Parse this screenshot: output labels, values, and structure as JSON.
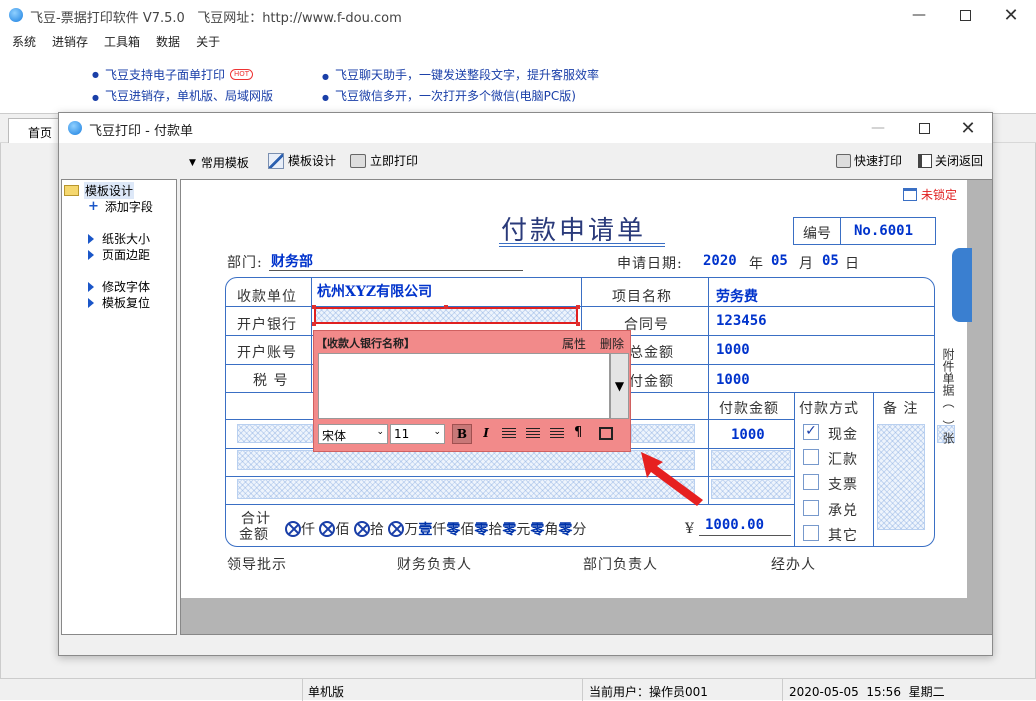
{
  "app": {
    "title": "飞豆-票据打印软件 V7.5.0   飞豆网址：http://www.f-dou.com",
    "menu": [
      "系统",
      "进销存",
      "工具箱",
      "数据",
      "关于"
    ],
    "ads": [
      {
        "text": "飞豆支持电子面单打印",
        "badge": "HOT"
      },
      {
        "text": "飞豆聊天助手，一键发送整段文字，提升客服效率"
      },
      {
        "text": "飞豆进销存，单机版、局域网版"
      },
      {
        "text": "飞豆微信多开，一次打开多个微信(电脑PC版)"
      }
    ],
    "home_tab": "首页"
  },
  "dialog": {
    "title": "飞豆打印 - 付款单",
    "toolbar": {
      "template_menu": "常用模板",
      "template_design": "模板设计",
      "print_now": "立即打印",
      "quick_print": "快速打印",
      "close_return": "关闭返回"
    },
    "sidebar": {
      "root": "模板设计",
      "add_field": "添加字段",
      "paper_size": "纸张大小",
      "page_margin": "页面边距",
      "edit_font": "修改字体",
      "reset_template": "模板复位"
    },
    "lock_status": "未锁定"
  },
  "form": {
    "title": "付款申请单",
    "number_label": "编号",
    "number_value": "No.6001",
    "dept_label": "部门:",
    "dept_value": "财务部",
    "date_label": "申请日期:",
    "date_year": "2020",
    "date_y": "年",
    "date_month": "05",
    "date_m": "月",
    "date_day": "05",
    "date_d": "日",
    "payee_label": "收款单位",
    "payee_value": "杭州XYZ有限公司",
    "bank_label": "开户银行",
    "account_label": "开户账号",
    "tax_label": "税 号",
    "project_label": "项目名称",
    "project_value": "劳务费",
    "contract_label": "合同号",
    "contract_value": "123456",
    "total_label": "合同总金额",
    "total_value": "1000",
    "paid_label": "已支付金额",
    "paid_value": "1000",
    "pay_amount_label": "付款金额",
    "pay_amount_value": "1000",
    "pay_method_label": "付款方式",
    "remark_label": "备 注",
    "methods": [
      "现金",
      "汇款",
      "支票",
      "承兑",
      "其它"
    ],
    "sum_label_1": "合计",
    "sum_label_2": "金额",
    "units": [
      "仟",
      "佰",
      "拾",
      "万",
      "仟",
      "佰",
      "拾",
      "元",
      "角",
      "分"
    ],
    "wan_digit": "壹",
    "zero": "零",
    "yuan_symbol": "¥",
    "sum_value": "1000.00",
    "attach": "附件单据（　）张",
    "sign_leader": "领导批示",
    "sign_finance": "财务负责人",
    "sign_dept": "部门负责人",
    "sign_handler": "经办人"
  },
  "field_editor": {
    "title": "【收款人银行名称】",
    "props": "属性",
    "delete": "删除",
    "font": "宋体",
    "size": "11",
    "bold": "B",
    "italic": "I"
  },
  "status": {
    "mode": "单机版",
    "user": "当前用户：操作员001",
    "datetime": "2020-05-05  15:56  星期二"
  }
}
